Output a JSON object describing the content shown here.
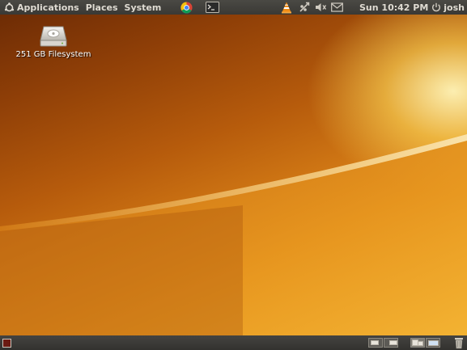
{
  "top_panel": {
    "menus": [
      "Applications",
      "Places",
      "System"
    ],
    "launchers": [
      {
        "name": "chrome-icon"
      },
      {
        "name": "terminal-icon"
      }
    ],
    "tray": [
      "vlc-icon",
      "network-icon",
      "volume-icon",
      "mail-icon"
    ],
    "clock": "Sun 10:42 PM",
    "user": "josh"
  },
  "desktop": {
    "icons": [
      {
        "label": "251 GB Filesystem",
        "icon": "drive-icon"
      }
    ]
  },
  "bottom_panel": {
    "workspaces": 4,
    "active_workspace": 3
  },
  "colors": {
    "panel": "#3c3b37",
    "panel_text": "#dfdbd2",
    "wallpaper_dark": "#7a3406",
    "wallpaper_light": "#f6bd38"
  }
}
